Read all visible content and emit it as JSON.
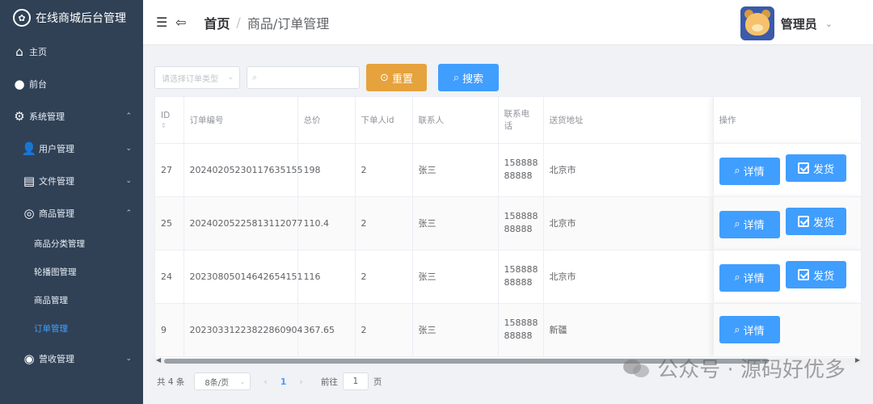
{
  "sidebar": {
    "title": "在线商城后台管理",
    "items": [
      {
        "label": "主页",
        "icon": "home-icon"
      },
      {
        "label": "前台",
        "icon": "drop-icon"
      },
      {
        "label": "系统管理",
        "icon": "gear-icon"
      },
      {
        "label": "用户管理",
        "icon": "user-icon"
      },
      {
        "label": "文件管理",
        "icon": "file-icon"
      },
      {
        "label": "商品管理",
        "icon": "search-product-icon"
      },
      {
        "label": "商品分类管理"
      },
      {
        "label": "轮播图管理"
      },
      {
        "label": "商品管理"
      },
      {
        "label": "订单管理"
      },
      {
        "label": "营收管理",
        "icon": "revenue-icon"
      }
    ]
  },
  "header": {
    "breadcrumb_home": "首页",
    "breadcrumb_current": "商品/订单管理",
    "user_name": "管理员"
  },
  "toolbar": {
    "order_type_placeholder": "请选择订单类型",
    "search_placeholder": "",
    "reset_label": "重置",
    "search_label": "搜索"
  },
  "table": {
    "columns": [
      "ID",
      "订单编号",
      "总价",
      "下单人id",
      "联系人",
      "联系电话",
      "送货地址",
      "操作"
    ],
    "rows": [
      {
        "id": "27",
        "order_no": "20240205230117635155",
        "total": "198",
        "user_id": "2",
        "contact": "张三",
        "phone1": "158888",
        "phone2": "88888",
        "address": "北京市",
        "actions": [
          "详情",
          "发货"
        ]
      },
      {
        "id": "25",
        "order_no": "20240205225813112077",
        "total": "110.4",
        "user_id": "2",
        "contact": "张三",
        "phone1": "158888",
        "phone2": "88888",
        "address": "北京市",
        "actions": [
          "详情",
          "发货"
        ]
      },
      {
        "id": "24",
        "order_no": "20230805014642654151",
        "total": "116",
        "user_id": "2",
        "contact": "张三",
        "phone1": "158888",
        "phone2": "88888",
        "address": "北京市",
        "actions": [
          "详情",
          "发货"
        ]
      },
      {
        "id": "9",
        "order_no": "20230331223822860904",
        "total": "367.65",
        "user_id": "2",
        "contact": "张三",
        "phone1": "158888",
        "phone2": "88888",
        "address": "新疆",
        "actions": [
          "详情"
        ]
      }
    ]
  },
  "pagination": {
    "total_text": "共 4 条",
    "page_size": "8条/页",
    "current_page": "1",
    "goto_label": "前往",
    "goto_value": "1",
    "page_unit": "页"
  },
  "watermark": "公众号 · 源码好优多",
  "colors": {
    "sidebar_bg": "#304156",
    "primary": "#409eff",
    "warning": "#e6a23c",
    "active_menu": "#409eff"
  }
}
